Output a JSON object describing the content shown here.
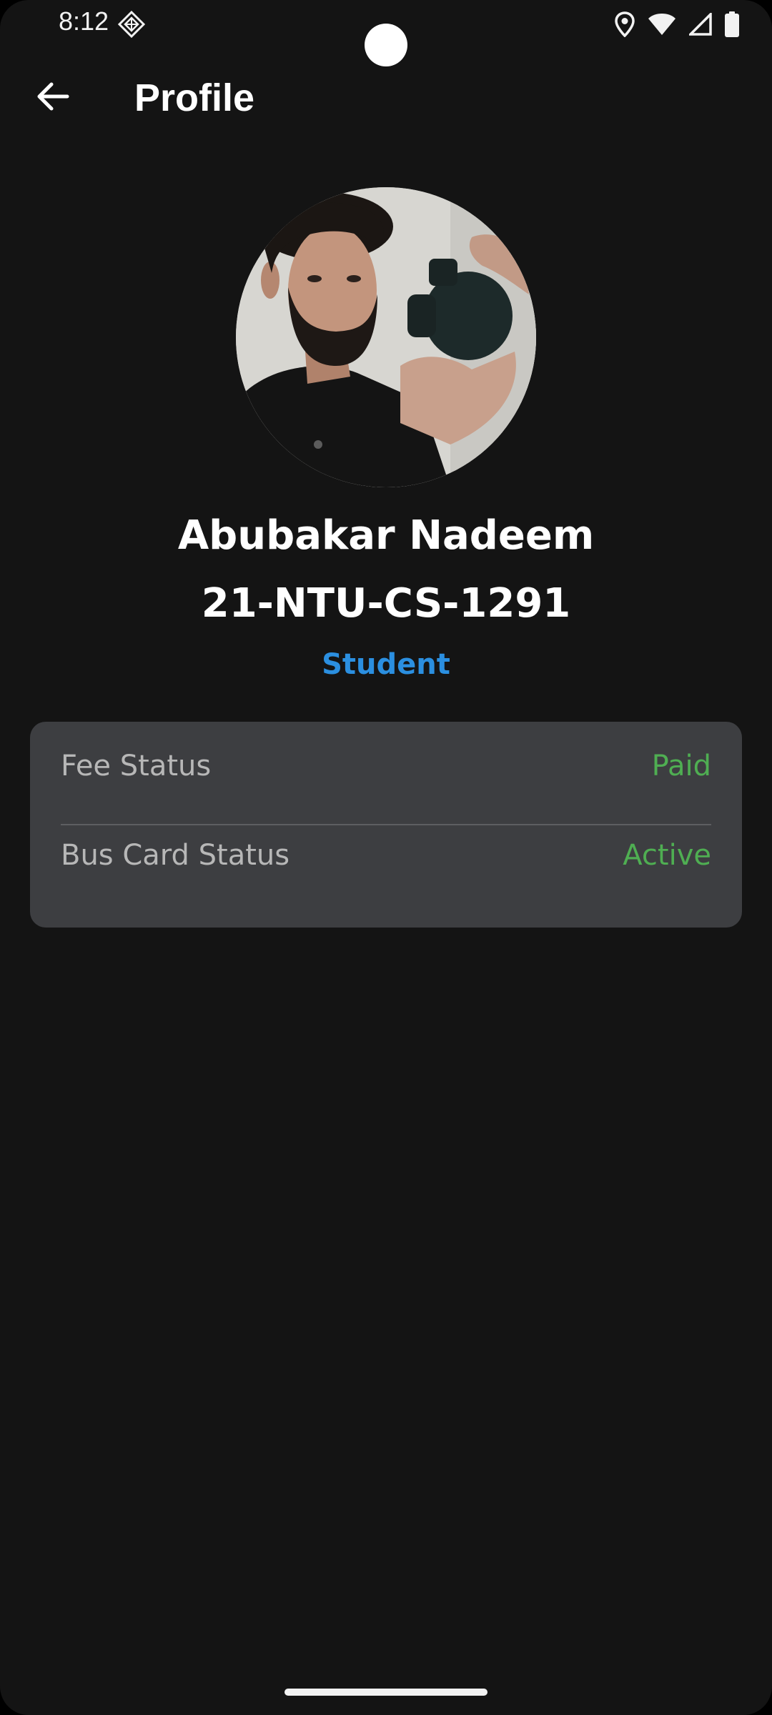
{
  "status_bar": {
    "time": "8:12",
    "app_icon": "diamond-pattern-icon",
    "right_icons": [
      "location-icon",
      "wifi-icon",
      "cellular-signal-icon",
      "battery-icon"
    ]
  },
  "app_bar": {
    "back_icon": "arrow-back-icon",
    "title": "Profile"
  },
  "profile": {
    "avatar": "user-photo",
    "name": "Abubakar Nadeem",
    "id": "21-NTU-CS-1291",
    "role": "Student"
  },
  "status_card": {
    "rows": [
      {
        "label": "Fee Status",
        "value": "Paid"
      },
      {
        "label": "Bus Card Status",
        "value": "Active"
      }
    ]
  },
  "colors": {
    "background": "#141414",
    "card": "#3d3e41",
    "role_accent": "#2b8fe0",
    "status_positive": "#4fae52",
    "label_text": "#b7b7b7"
  }
}
